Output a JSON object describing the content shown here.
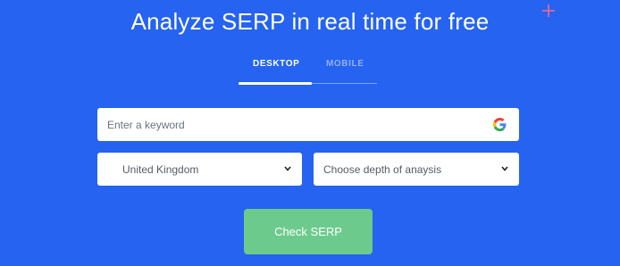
{
  "header": {
    "title": "Analyze SERP in real time for free"
  },
  "tabs": [
    {
      "label": "DESKTOP",
      "active": true
    },
    {
      "label": "MOBILE",
      "active": false
    }
  ],
  "form": {
    "keyword": {
      "placeholder": "Enter a keyword",
      "value": "",
      "icon": "google-g-icon"
    },
    "country": {
      "selected": "United Kingdom",
      "icon": "chevron-down-icon"
    },
    "depth": {
      "selected": "Choose depth of anaysis",
      "icon": "chevron-down-icon"
    },
    "submit_label": "Check SERP"
  },
  "colors": {
    "background": "#2563f0",
    "button": "#6ccb8c",
    "accent_sparkle": "#ff6b8a"
  }
}
